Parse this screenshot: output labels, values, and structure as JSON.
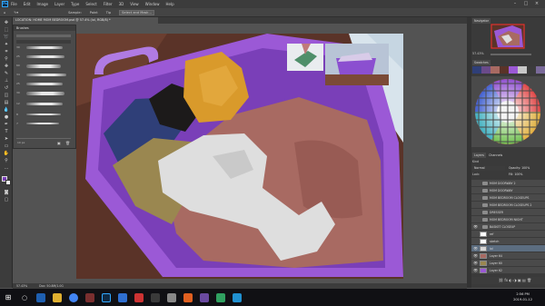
{
  "menubar": {
    "app_logo": "Ps",
    "items": [
      "File",
      "Edit",
      "Image",
      "Layer",
      "Type",
      "Select",
      "Filter",
      "3D",
      "View",
      "Window",
      "Help"
    ],
    "window_controls": [
      "–",
      "□",
      "×"
    ]
  },
  "options": {
    "items": [
      "Sample:",
      "Point",
      "Tip",
      "Select and Mask..."
    ]
  },
  "document": {
    "tab_title": "LOCATION: HOME MOM BEDROOM.psd @ 57.4% (lol, RGB/8) *",
    "status_zoom": "57.43%",
    "status_doc": "Doc: 50.8M/1.0G"
  },
  "brush_panel": {
    "title": "Brushes",
    "sizes": [
      "30",
      "25",
      "60",
      "34",
      "25",
      "30",
      "12",
      "8",
      "7"
    ],
    "footer_size": "10 px"
  },
  "right_panels": {
    "navigator_tab": "Navigator",
    "zoom": "57.43%",
    "swatches_tab": "Swatches",
    "layers_tab": "Layers",
    "channels_tab": "Channels",
    "kind": "Kind",
    "blend_mode": "Normal",
    "opacity": "Opacity: 100%",
    "fill": "Fill: 100%",
    "lock": "Lock:"
  },
  "layers": [
    {
      "name": "MOM DOORWAY 2",
      "type": "folder"
    },
    {
      "name": "MOM DOORWAY",
      "type": "folder"
    },
    {
      "name": "MOM BEDROOM CLOSEUPS",
      "type": "folder"
    },
    {
      "name": "MOM BEDROOM CLOSEUPS 2",
      "type": "folder"
    },
    {
      "name": "DRESSER",
      "type": "folder"
    },
    {
      "name": "MOM BEDROOM NIGHT",
      "type": "folder"
    },
    {
      "name": "BASKET CLOSEUP",
      "type": "folder"
    },
    {
      "name": "ref",
      "type": "layer"
    },
    {
      "name": "sketch",
      "type": "layer"
    },
    {
      "name": "lol",
      "type": "layer"
    },
    {
      "name": "Layer 64",
      "type": "layer"
    },
    {
      "name": "Layer 60",
      "type": "layer"
    },
    {
      "name": "Layer 62",
      "type": "layer"
    }
  ],
  "taskbar": {
    "time": "2:56 PM",
    "date": "2019-01-12"
  },
  "colors": {
    "basket": "#9b59d6",
    "basket_dark": "#7a3fb8",
    "floor": "#5a3328",
    "cloth_brown": "#a86a62",
    "cloth_white": "#dedede",
    "cloth_orange": "#d99a2b",
    "cloth_blue": "#2f3f78",
    "cloth_tan": "#9a8750",
    "cloth_black": "#1c1a1a"
  }
}
